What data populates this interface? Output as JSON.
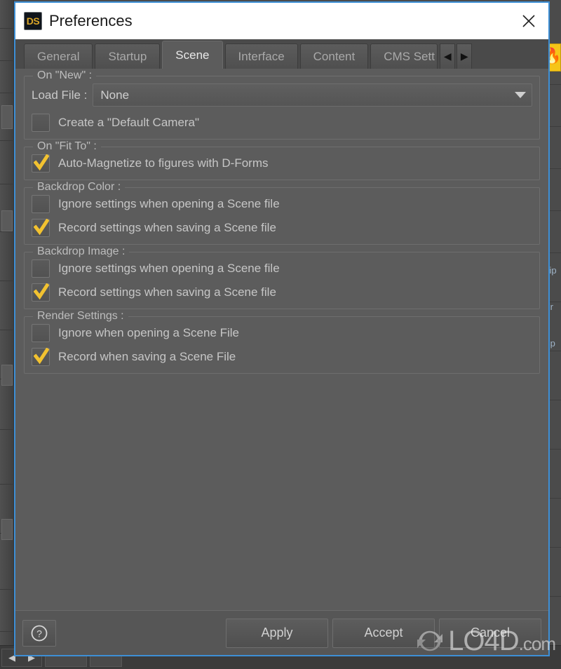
{
  "window": {
    "logo_text": "DS",
    "title": "Preferences",
    "close_icon": "close-icon"
  },
  "tabs": {
    "items": [
      {
        "label": "General",
        "active": false
      },
      {
        "label": "Startup",
        "active": false
      },
      {
        "label": "Scene",
        "active": true
      },
      {
        "label": "Interface",
        "active": false
      },
      {
        "label": "Content",
        "active": false
      },
      {
        "label": "CMS Sett",
        "active": false
      }
    ],
    "scroll_left": "◀",
    "scroll_right": "▶"
  },
  "groups": [
    {
      "title": "On \"New\" :",
      "field": {
        "label": "Load File :",
        "value": "None"
      },
      "checkboxes": [
        {
          "label": "Create a \"Default Camera\"",
          "checked": false
        }
      ]
    },
    {
      "title": "On \"Fit To\" :",
      "checkboxes": [
        {
          "label": "Auto-Magnetize to figures with D-Forms",
          "checked": true
        }
      ]
    },
    {
      "title": "Backdrop Color :",
      "checkboxes": [
        {
          "label": "Ignore settings when opening a Scene file",
          "checked": false
        },
        {
          "label": "Record settings when saving a Scene file",
          "checked": true
        }
      ]
    },
    {
      "title": "Backdrop Image :",
      "checkboxes": [
        {
          "label": "Ignore settings when opening a Scene file",
          "checked": false
        },
        {
          "label": "Record settings when saving a Scene file",
          "checked": true
        }
      ]
    },
    {
      "title": "Render Settings :",
      "checkboxes": [
        {
          "label": "Ignore when opening a Scene File",
          "checked": false
        },
        {
          "label": "Record when saving a Scene File",
          "checked": true
        }
      ]
    }
  ],
  "footer": {
    "help_icon": "help-icon",
    "apply_label": "Apply",
    "accept_label": "Accept",
    "cancel_label": "Cancel"
  },
  "background": {
    "right_labels": [
      "Tip",
      "Pr",
      "Sp"
    ],
    "yellow_button_icon": "flame-icon"
  },
  "watermark": {
    "text": "LO4D",
    "suffix": ".com"
  },
  "colors": {
    "accent_border": "#3d8fd6",
    "checkmark": "#f2c230",
    "logo_gold": "#d9a528",
    "dialog_bg": "#5c5c5c",
    "titlebar_bg": "#ffffff",
    "yellow_button": "#f5c518"
  }
}
